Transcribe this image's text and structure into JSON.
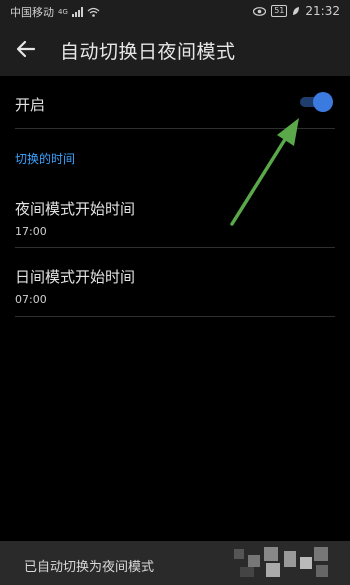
{
  "status_bar": {
    "carrier": "中国移动",
    "network": "4G",
    "battery": "51",
    "time": "21:32"
  },
  "app_bar": {
    "title": "自动切换日夜间模式"
  },
  "enable_row": {
    "label": "开启",
    "toggle_on": true
  },
  "section": {
    "header": "切换的时间"
  },
  "night_start": {
    "label": "夜间模式开始时间",
    "value": "17:00"
  },
  "day_start": {
    "label": "日间模式开始时间",
    "value": "07:00"
  },
  "toast": {
    "message": "已自动切换为夜间模式"
  },
  "colors": {
    "accent": "#3ba3ff",
    "toggle_knob": "#3b7be0",
    "annotation_arrow": "#5aa84a"
  }
}
